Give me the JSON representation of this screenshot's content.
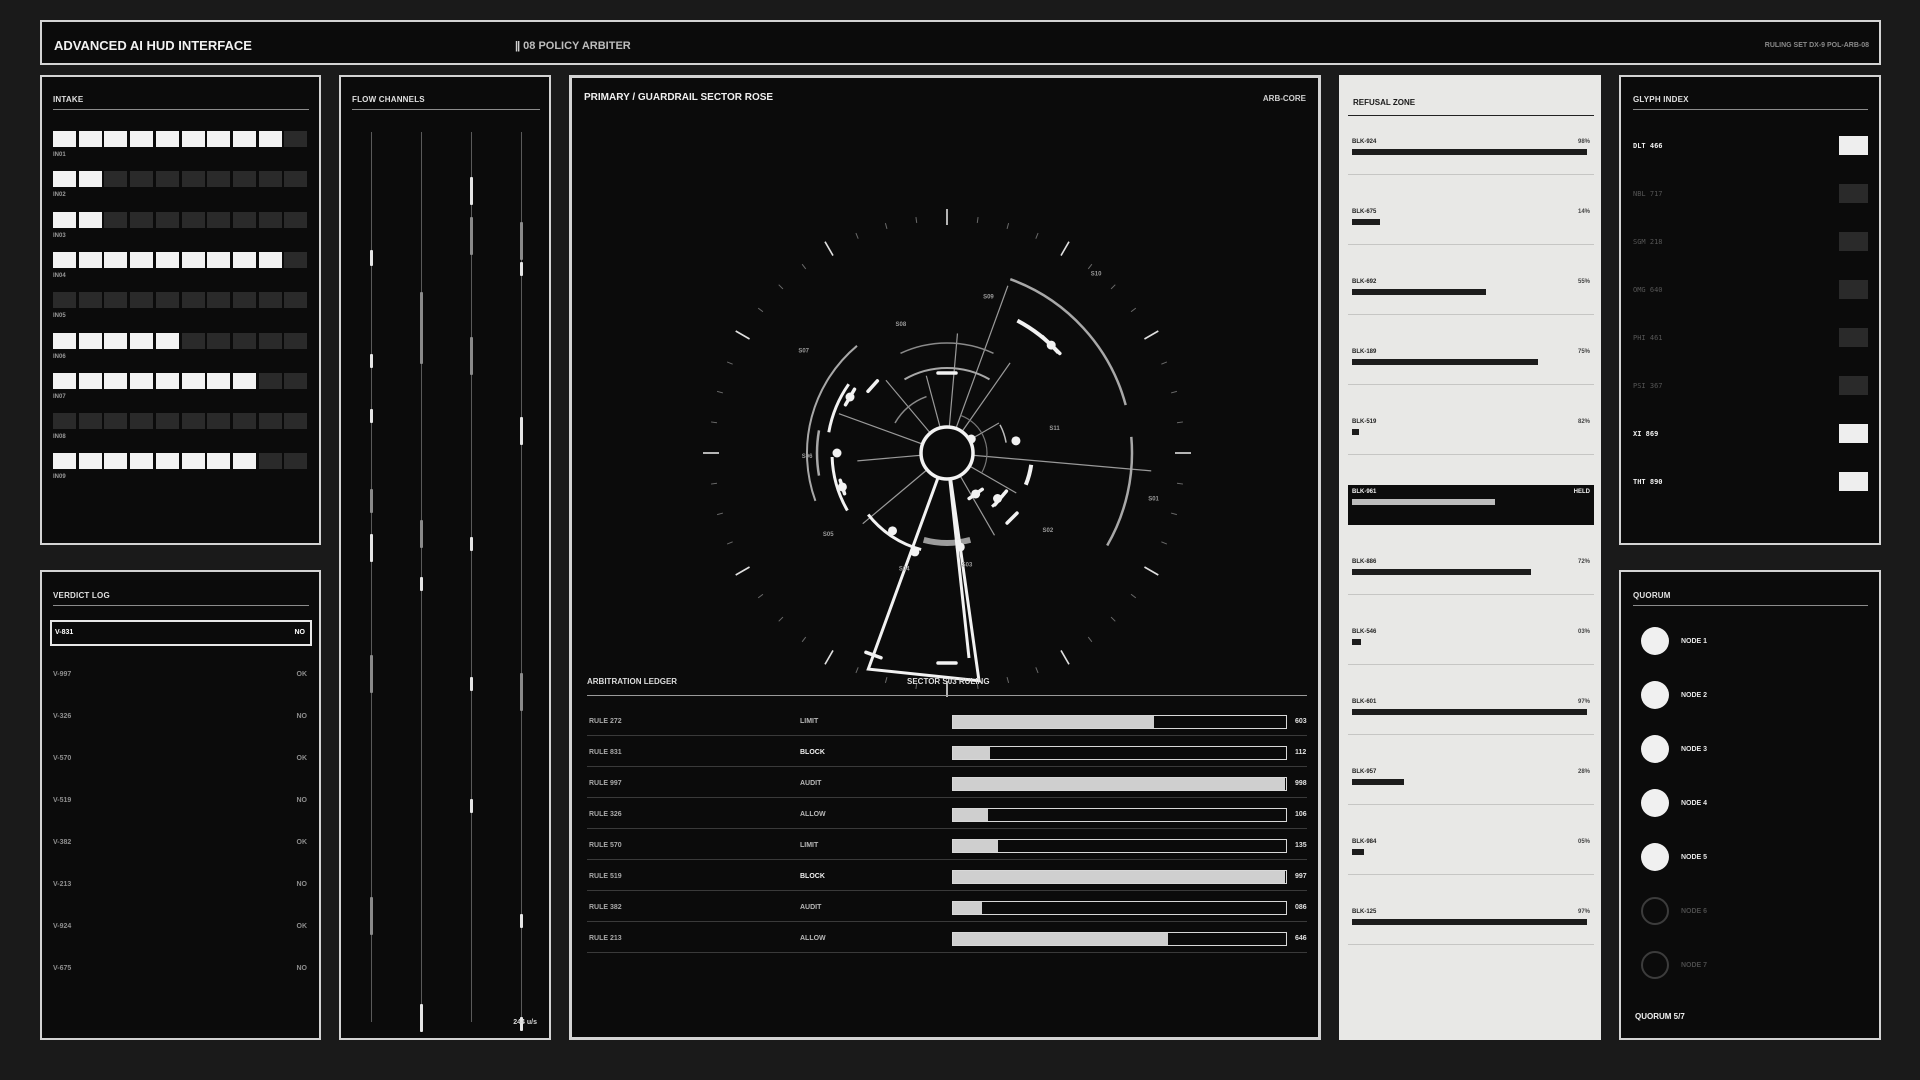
{
  "header": {
    "app_title": "ADVANCED AI HUD INTERFACE",
    "module_title": "08 POLICY ARBITER",
    "ruling_set": "RULING SET DX-9 POL-ARB-08"
  },
  "intake": {
    "title": "INTAKE",
    "rows": [
      {
        "label": "",
        "filled": 9
      },
      {
        "label": "IN01",
        "filled": 2
      },
      {
        "label": "IN02",
        "filled": 2
      },
      {
        "label": "IN03",
        "filled": 9
      },
      {
        "label": "IN04",
        "filled": 0
      },
      {
        "label": "IN05",
        "filled": 5
      },
      {
        "label": "IN06",
        "filled": 8
      },
      {
        "label": "IN07",
        "filled": 0
      },
      {
        "label": "IN08",
        "filled": 8
      }
    ],
    "last_label": "IN09"
  },
  "verdict_log": {
    "title": "VERDICT LOG",
    "entries": [
      {
        "id": "V-831",
        "status": "NO",
        "selected": true
      },
      {
        "id": "V-997",
        "status": "OK"
      },
      {
        "id": "V-326",
        "status": "NO"
      },
      {
        "id": "V-570",
        "status": "OK"
      },
      {
        "id": "V-519",
        "status": "NO"
      },
      {
        "id": "V-382",
        "status": "OK"
      },
      {
        "id": "V-213",
        "status": "NO"
      },
      {
        "id": "V-924",
        "status": "OK"
      },
      {
        "id": "V-675",
        "status": "NO"
      }
    ]
  },
  "flow_channels": {
    "title": "FLOW CHANNELS",
    "rate": "244 u/s"
  },
  "primary": {
    "title": "PRIMARY / GUARDRAIL SECTOR ROSE",
    "tag": "ARB-CORE",
    "sectors": [
      "S01",
      "S02",
      "S03",
      "S04",
      "S05",
      "S06",
      "S07",
      "S08",
      "S09",
      "S10",
      "S11"
    ],
    "ledger_title": "ARBITRATION LEDGER",
    "ruling_title": "SECTOR S03 RULING",
    "ledger": [
      {
        "rule": "RULE 272",
        "action": "LIMIT",
        "value": 603,
        "display": "603"
      },
      {
        "rule": "RULE 831",
        "action": "BLOCK",
        "value": 112,
        "display": "112"
      },
      {
        "rule": "RULE 997",
        "action": "AUDIT",
        "value": 998,
        "display": "998"
      },
      {
        "rule": "RULE 326",
        "action": "ALLOW",
        "value": 106,
        "display": "106"
      },
      {
        "rule": "RULE 570",
        "action": "LIMIT",
        "value": 135,
        "display": "135"
      },
      {
        "rule": "RULE 519",
        "action": "BLOCK",
        "value": 997,
        "display": "997"
      },
      {
        "rule": "RULE 382",
        "action": "AUDIT",
        "value": 86,
        "display": "086"
      },
      {
        "rule": "RULE 213",
        "action": "ALLOW",
        "value": 646,
        "display": "646"
      }
    ]
  },
  "refusal_zone": {
    "title": "REFUSAL ZONE",
    "blocks": [
      {
        "id": "BLK-924",
        "pct": "98%",
        "fill": 1.0
      },
      {
        "id": "BLK-675",
        "pct": "14%",
        "fill": 0.12
      },
      {
        "id": "BLK-692",
        "pct": "55%",
        "fill": 0.57
      },
      {
        "id": "BLK-189",
        "pct": "75%",
        "fill": 0.79
      },
      {
        "id": "BLK-519",
        "pct": "82%",
        "fill": 0.03
      },
      {
        "id": "BLK-961",
        "pct": "HELD",
        "fill": 0.61,
        "held": true
      },
      {
        "id": "BLK-886",
        "pct": "72%",
        "fill": 0.76
      },
      {
        "id": "BLK-546",
        "pct": "03%",
        "fill": 0.04
      },
      {
        "id": "BLK-601",
        "pct": "97%",
        "fill": 1.0
      },
      {
        "id": "BLK-957",
        "pct": "28%",
        "fill": 0.22
      },
      {
        "id": "BLK-984",
        "pct": "05%",
        "fill": 0.05
      },
      {
        "id": "BLK-125",
        "pct": "97%",
        "fill": 1.0
      }
    ]
  },
  "glyph_index": {
    "title": "GLYPH INDEX",
    "glyphs": [
      {
        "label": "DLT 466",
        "active": true
      },
      {
        "label": "NBL 717",
        "active": false
      },
      {
        "label": "SGM 218",
        "active": false
      },
      {
        "label": "OMG 640",
        "active": false
      },
      {
        "label": "PHI 461",
        "active": false
      },
      {
        "label": "PSI 367",
        "active": false
      },
      {
        "label": "XI 869",
        "active": true
      },
      {
        "label": "THT 890",
        "active": true
      }
    ]
  },
  "quorum": {
    "title": "QUORUM",
    "nodes": [
      {
        "label": "NODE 1",
        "active": true
      },
      {
        "label": "NODE 2",
        "active": true
      },
      {
        "label": "NODE 3",
        "active": true
      },
      {
        "label": "NODE 4",
        "active": true
      },
      {
        "label": "NODE 5",
        "active": true
      },
      {
        "label": "NODE 6",
        "active": false
      },
      {
        "label": "NODE 7",
        "active": false
      }
    ],
    "count": "QUORUM 5/7"
  },
  "colors": {
    "background": "#1a1a1a",
    "panel": "#0b0b0b",
    "accent": "#f0f0f0",
    "refusal_panel": "#e8e8e6"
  }
}
